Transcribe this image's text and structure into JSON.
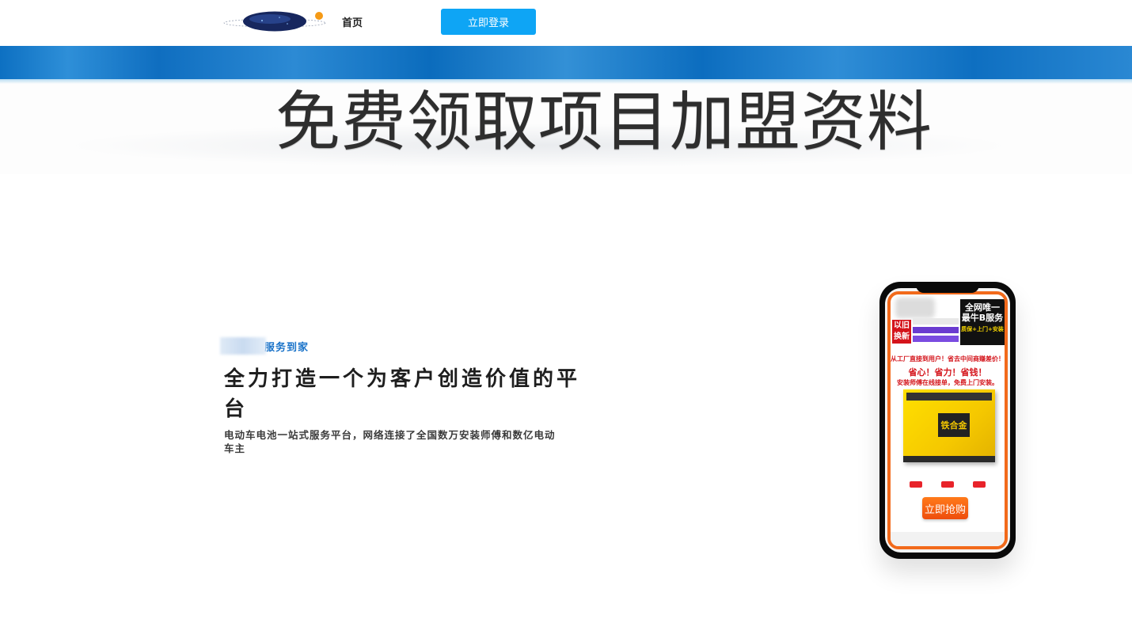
{
  "header": {
    "nav_home": "首页",
    "login_button": "立即登录"
  },
  "banner": {
    "title": "免费领取项目加盟资料"
  },
  "hero": {
    "eyebrow": "服务到家",
    "title": "全力打造一个为客户创造价值的平台",
    "description": "电动车电池一站式服务平台，网络连接了全国数万安装师傅和数亿电动车主"
  },
  "phone_ad": {
    "exchange_badge": "以旧换新",
    "service_title": "全网唯一 最牛B服务",
    "service_sub": "质保+上门+安装",
    "slogan_line1": "从工厂直接到用户！省去中间商赚差价！",
    "slogan_line2": "省心！省力！省钱！",
    "slogan_line3": "安装师傅在线接单，免费上门安装。",
    "product_label": "铁合金",
    "buy_button": "立即抢购"
  },
  "colors": {
    "login_button_bg": "#0ea5f5",
    "eyebrow_text": "#1a73c9",
    "banner_blue": "#0d70c2",
    "ad_border": "#f26a1b",
    "ad_red": "#d4141b"
  }
}
